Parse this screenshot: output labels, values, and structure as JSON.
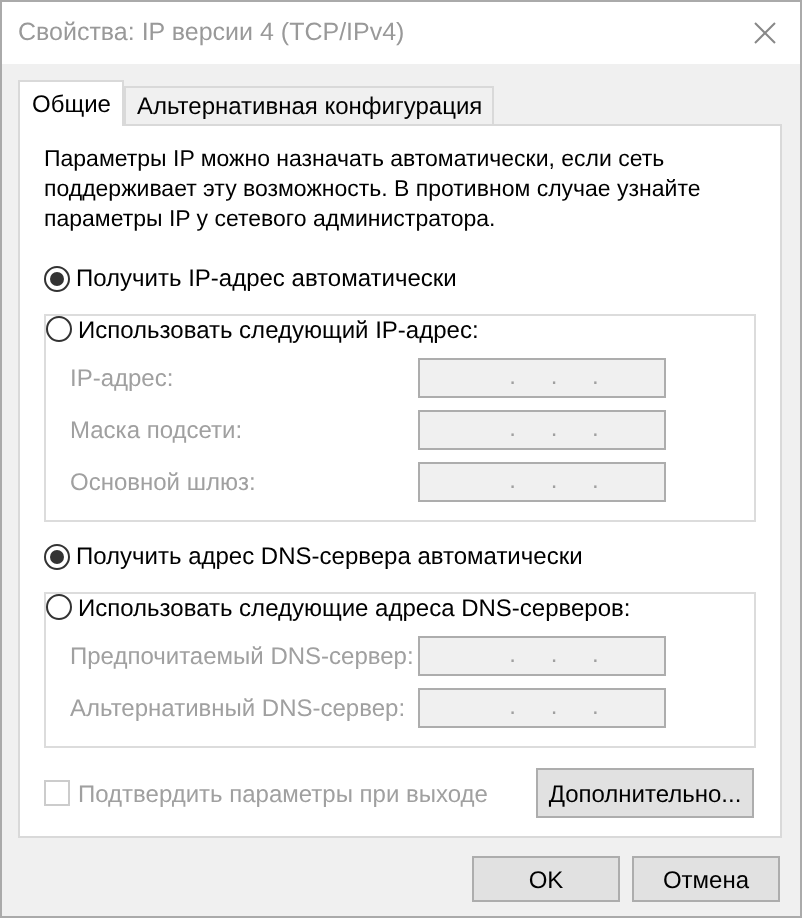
{
  "window": {
    "title": "Свойства: IP версии 4 (TCP/IPv4)"
  },
  "tabs": [
    {
      "label": "Общие",
      "selected": true
    },
    {
      "label": "Альтернативная конфигурация",
      "selected": false
    }
  ],
  "description": "Параметры IP можно назначать автоматически, если сеть поддерживает эту возможность. В противном случае узнайте параметры IP у сетевого администратора.",
  "ip_section": {
    "options": [
      {
        "label": "Получить IP-адрес автоматически",
        "selected": true
      },
      {
        "label": "Использовать следующий IP-адрес:",
        "selected": false
      }
    ],
    "fields": [
      {
        "label": "IP-адрес:",
        "value": ". . .",
        "disabled": true
      },
      {
        "label": "Маска подсети:",
        "value": ". . .",
        "disabled": true
      },
      {
        "label": "Основной шлюз:",
        "value": ". . .",
        "disabled": true
      }
    ]
  },
  "dns_section": {
    "options": [
      {
        "label": "Получить адрес DNS-сервера автоматически",
        "selected": true
      },
      {
        "label": "Использовать следующие адреса DNS-серверов:",
        "selected": false
      }
    ],
    "fields": [
      {
        "label": "Предпочитаемый DNS-сервер:",
        "value": ". . .",
        "disabled": true
      },
      {
        "label": "Альтернативный DNS-сервер:",
        "value": ". . .",
        "disabled": true
      }
    ]
  },
  "validate_checkbox": {
    "label": "Подтвердить параметры при выходе",
    "checked": false,
    "disabled": true
  },
  "advanced_button": "Дополнительно...",
  "buttons": [
    "OK",
    "Отмена"
  ]
}
